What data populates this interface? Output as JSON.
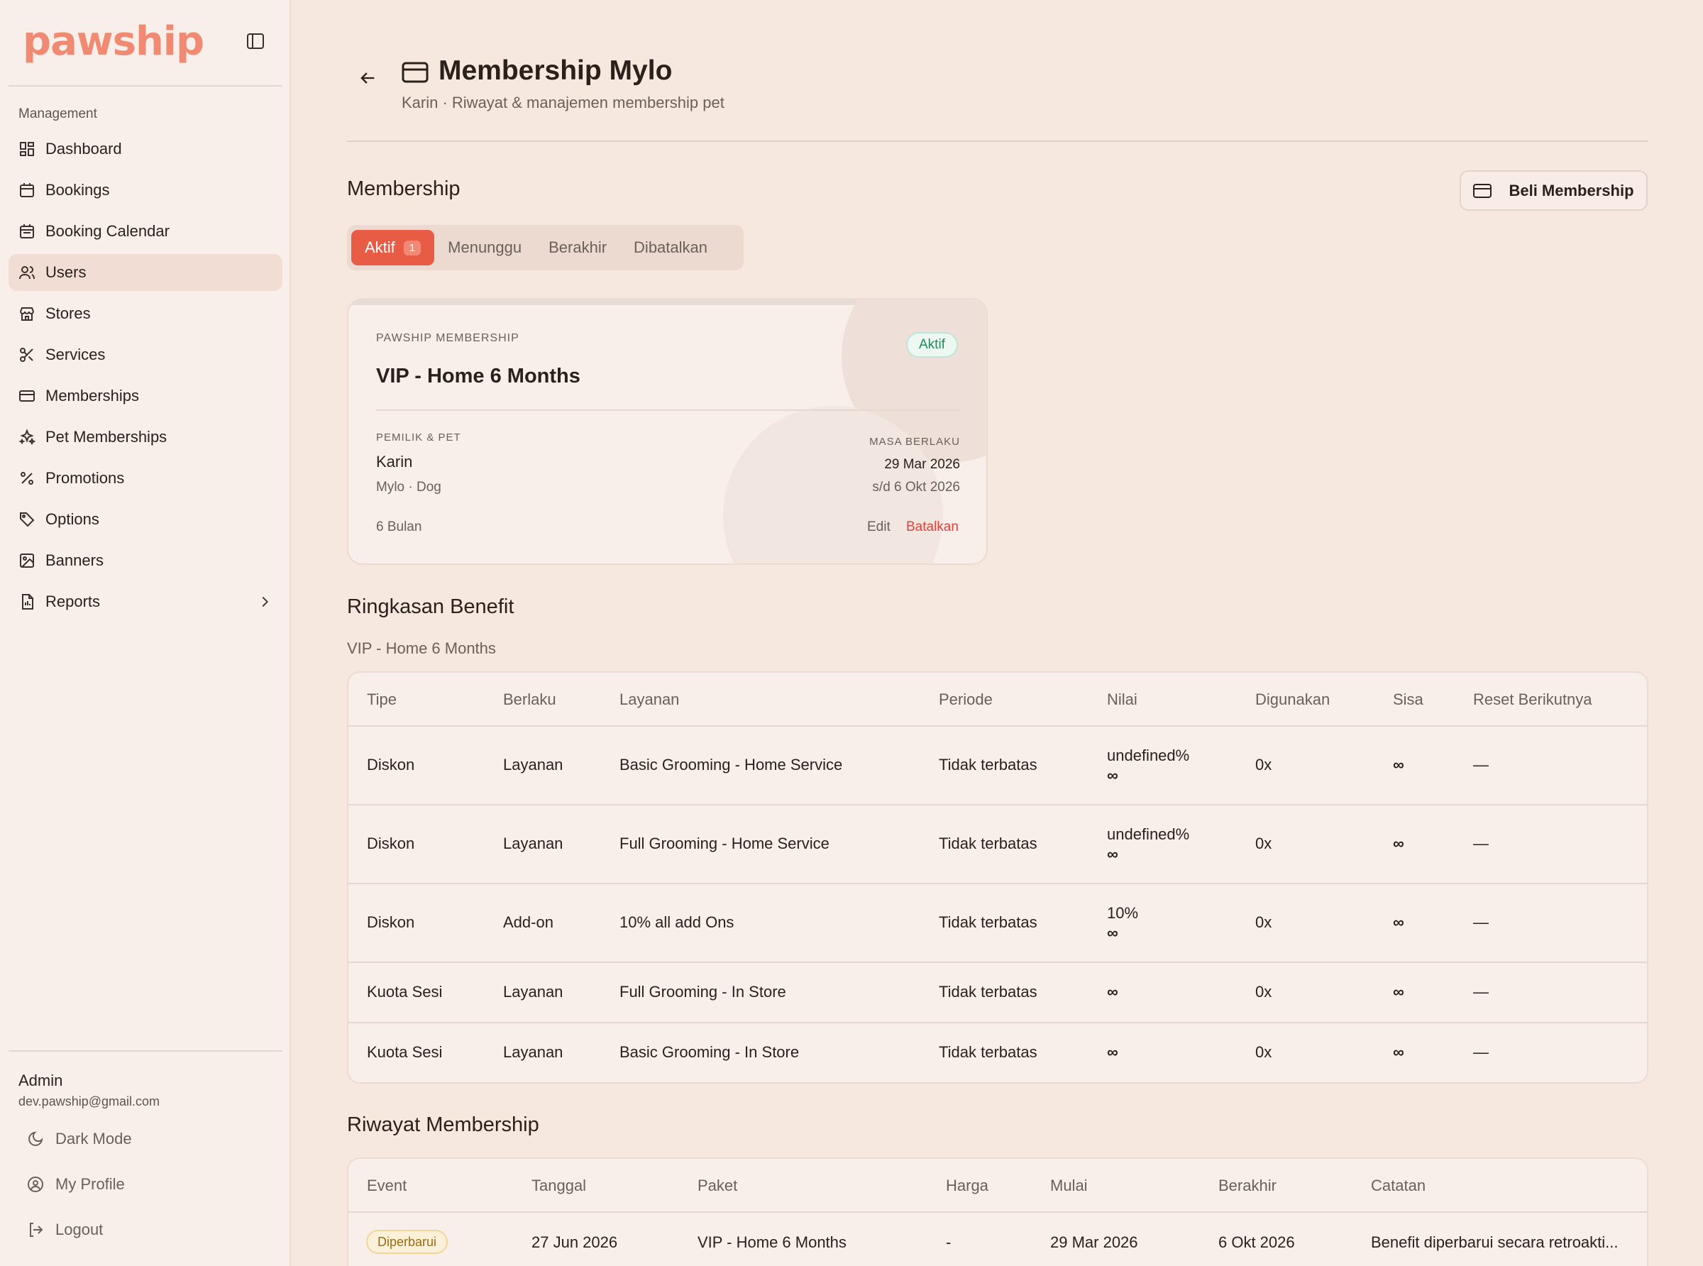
{
  "app": {
    "logo": "pawship"
  },
  "sidebar": {
    "section": "Management",
    "items": [
      {
        "label": "Dashboard",
        "icon": "dashboard-icon"
      },
      {
        "label": "Bookings",
        "icon": "calendar-icon"
      },
      {
        "label": "Booking Calendar",
        "icon": "calendar-icon"
      },
      {
        "label": "Users",
        "icon": "users-icon",
        "active": true
      },
      {
        "label": "Stores",
        "icon": "store-icon"
      },
      {
        "label": "Services",
        "icon": "scissors-icon"
      },
      {
        "label": "Memberships",
        "icon": "card-icon"
      },
      {
        "label": "Pet Memberships",
        "icon": "sparkles-icon"
      },
      {
        "label": "Promotions",
        "icon": "percent-icon"
      },
      {
        "label": "Options",
        "icon": "tag-icon"
      },
      {
        "label": "Banners",
        "icon": "image-icon"
      },
      {
        "label": "Reports",
        "icon": "report-icon",
        "has_submenu": true
      }
    ],
    "admin": {
      "name": "Admin",
      "email": "dev.pawship@gmail.com"
    },
    "footer": {
      "dark_mode": "Dark Mode",
      "profile": "My Profile",
      "logout": "Logout"
    }
  },
  "header": {
    "title": "Membership Mylo",
    "subtitle": "Karin · Riwayat & manajemen membership pet"
  },
  "membership": {
    "heading": "Membership",
    "buy_label": "Beli Membership",
    "tabs": [
      {
        "label": "Aktif",
        "count": "1",
        "active": true
      },
      {
        "label": "Menunggu"
      },
      {
        "label": "Berakhir"
      },
      {
        "label": "Dibatalkan"
      }
    ],
    "card": {
      "brand": "PAWSHIP MEMBERSHIP",
      "status": "Aktif",
      "plan": "VIP - Home 6 Months",
      "owner_label": "PEMILIK & PET",
      "owner": "Karin",
      "pet": "Mylo · Dog",
      "validity_label": "MASA BERLAKU",
      "start": "29 Mar 2026",
      "end": "s/d 6 Okt 2026",
      "duration": "6 Bulan",
      "edit": "Edit",
      "cancel": "Batalkan"
    }
  },
  "benefits": {
    "heading": "Ringkasan Benefit",
    "caption": "VIP - Home 6 Months",
    "headers": [
      "Tipe",
      "Berlaku",
      "Layanan",
      "Periode",
      "Nilai",
      "Digunakan",
      "Sisa",
      "Reset Berikutnya"
    ],
    "rows": [
      {
        "tipe": "Diskon",
        "berlaku": "Layanan",
        "layanan": "Basic Grooming - Home Service",
        "periode": "Tidak terbatas",
        "nilai": "undefined%",
        "nilai2": "∞",
        "digunakan": "0x",
        "sisa": "∞",
        "reset": "—"
      },
      {
        "tipe": "Diskon",
        "berlaku": "Layanan",
        "layanan": "Full Grooming - Home Service",
        "periode": "Tidak terbatas",
        "nilai": "undefined%",
        "nilai2": "∞",
        "digunakan": "0x",
        "sisa": "∞",
        "reset": "—"
      },
      {
        "tipe": "Diskon",
        "berlaku": "Add-on",
        "layanan": "10% all add Ons",
        "periode": "Tidak terbatas",
        "nilai": "10%",
        "nilai2": "∞",
        "digunakan": "0x",
        "sisa": "∞",
        "reset": "—"
      },
      {
        "tipe": "Kuota Sesi",
        "berlaku": "Layanan",
        "layanan": "Full Grooming - In Store",
        "periode": "Tidak terbatas",
        "nilai": "∞",
        "digunakan": "0x",
        "sisa": "∞",
        "reset": "—"
      },
      {
        "tipe": "Kuota Sesi",
        "berlaku": "Layanan",
        "layanan": "Basic Grooming - In Store",
        "periode": "Tidak terbatas",
        "nilai": "∞",
        "digunakan": "0x",
        "sisa": "∞",
        "reset": "—"
      }
    ]
  },
  "history": {
    "heading": "Riwayat Membership",
    "headers": [
      "Event",
      "Tanggal",
      "Paket",
      "Harga",
      "Mulai",
      "Berakhir",
      "Catatan"
    ],
    "rows": [
      {
        "event": "Diperbarui",
        "tanggal": "27 Jun 2026",
        "paket": "VIP - Home 6 Months",
        "harga": "-",
        "mulai": "29 Mar 2026",
        "berakhir": "6 Okt 2026",
        "catatan": "Benefit diperbarui secara retroakti..."
      }
    ]
  },
  "colors": {
    "accent": "#e85c45",
    "success": "#1f9a66",
    "background": "#f7e8df"
  }
}
